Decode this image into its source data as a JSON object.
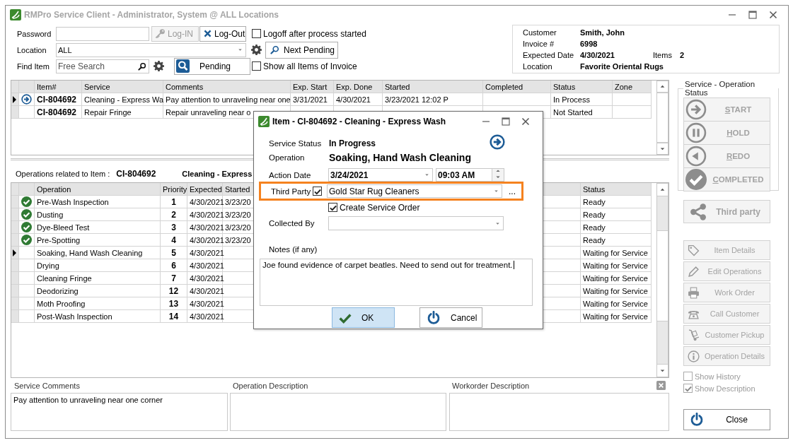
{
  "window": {
    "title": "RMPro Service Client - Administrator, System @ ALL Locations"
  },
  "login": {
    "password_label": "Password",
    "buttons": [
      {
        "kind": "login",
        "label": "Log-IN",
        "disabled": true
      },
      {
        "kind": "logout",
        "label": "Log-Out",
        "disabled": false
      }
    ],
    "logoff_after": {
      "label": "Logoff after process started",
      "checked": false
    }
  },
  "location": {
    "label": "Location",
    "value": "ALL",
    "next_pending": "Next Pending"
  },
  "find": {
    "label": "Find Item",
    "placeholder": "Free Search",
    "pending": "Pending",
    "show_all": {
      "label": "Show all Items of Invoice",
      "checked": false
    }
  },
  "invoice": {
    "fields": [
      {
        "label": "Customer",
        "value": "Smith, John"
      },
      {
        "label": "Invoice #",
        "value": "6998"
      },
      {
        "label": "Expected Date",
        "value": "4/30/2021"
      },
      {
        "label": "Location",
        "value": "Favorite Oriental Rugs"
      }
    ],
    "items_label": "Items",
    "items_value": "2"
  },
  "items_table": {
    "columns": [
      "Item#",
      "Service",
      "Comments",
      "Exp. Start",
      "Exp. Done",
      "Started",
      "Completed",
      "Status",
      "Zone"
    ],
    "rows": [
      {
        "selected": true,
        "current": true,
        "item": "CI-804692",
        "service": "Cleaning - Express Wa",
        "comments": "Pay attention to unraveling near one",
        "exp_start": "3/31/2021",
        "exp_done": "4/30/2021",
        "started": "3/23/2021 12:02 P",
        "status": "In Process"
      },
      {
        "selected": false,
        "current": false,
        "item": "CI-804692",
        "service": "Repair Fringe",
        "comments": "Repair unraveling near o",
        "status": "Not Started"
      }
    ]
  },
  "operations": {
    "label": "Operations related to Item :",
    "item": "CI-804692",
    "service": "Cleaning - Express",
    "columns": [
      "Operation",
      "Priority",
      "Expected",
      "Started",
      "Status"
    ],
    "rows": [
      {
        "selected": false,
        "done": true,
        "operation": "Pre-Wash Inspection",
        "priority": "1",
        "expected": "4/30/2021",
        "started": "3/23/20",
        "status": "Ready"
      },
      {
        "selected": false,
        "done": true,
        "operation": "Dusting",
        "priority": "2",
        "expected": "4/30/2021",
        "started": "3/23/20",
        "status": "Ready"
      },
      {
        "selected": false,
        "done": true,
        "operation": "Dye-Bleed Test",
        "priority": "3",
        "expected": "4/30/2021",
        "started": "3/23/20",
        "status": "Ready"
      },
      {
        "selected": false,
        "done": true,
        "operation": "Pre-Spotting",
        "priority": "4",
        "expected": "4/30/2021",
        "started": "3/23/20",
        "status": "Ready"
      },
      {
        "selected": true,
        "done": false,
        "operation": "Soaking, Hand Wash Cleaning",
        "priority": "5",
        "expected": "4/30/2021",
        "status": "Waiting for Service"
      },
      {
        "selected": false,
        "done": false,
        "operation": "Drying",
        "priority": "6",
        "expected": "4/30/2021",
        "status": "Waiting for Service"
      },
      {
        "selected": false,
        "done": false,
        "operation": "Cleaning Fringe",
        "priority": "7",
        "expected": "4/30/2021",
        "status": "Waiting for Service"
      },
      {
        "selected": false,
        "done": false,
        "operation": "Deodorizing",
        "priority": "12",
        "expected": "4/30/2021",
        "status": "Waiting for Service"
      },
      {
        "selected": false,
        "done": false,
        "operation": "Moth Proofing",
        "priority": "13",
        "expected": "4/30/2021",
        "status": "Waiting for Service"
      },
      {
        "selected": false,
        "done": false,
        "operation": "Post-Wash Inspection",
        "priority": "14",
        "expected": "4/30/2021",
        "status": "Waiting for Service"
      }
    ]
  },
  "panes": [
    {
      "title": "Service Comments",
      "text": "Pay attention to unraveling near one corner"
    },
    {
      "title": "Operation Description"
    },
    {
      "title": "Workorder Description"
    }
  ],
  "side": {
    "group_title": "Service - Operation Status",
    "status_buttons": [
      {
        "kind": "start",
        "label": "START",
        "disabled": true
      },
      {
        "kind": "hold",
        "label": "HOLD",
        "disabled": true
      },
      {
        "kind": "redo",
        "label": "REDO",
        "disabled": true
      },
      {
        "kind": "completed",
        "label": "COMPLETED",
        "disabled": true
      }
    ],
    "third_party": {
      "label": "Third party",
      "disabled": true
    },
    "actions": [
      {
        "kind": "tag",
        "label": "Item Details",
        "disabled": true
      },
      {
        "kind": "pencil",
        "label": "Edit Operations",
        "disabled": true
      },
      {
        "kind": "printer",
        "label": "Work Order",
        "disabled": true
      },
      {
        "kind": "phone",
        "label": "Call Customer",
        "disabled": true
      },
      {
        "kind": "dolly",
        "label": "Customer Pickup",
        "disabled": true
      },
      {
        "kind": "info",
        "label": "Operation Details",
        "disabled": true
      }
    ],
    "options": [
      {
        "label": "Show History",
        "checked": false,
        "disabled": true
      },
      {
        "label": "Show Description",
        "checked": true,
        "disabled": true
      }
    ],
    "close": "Close"
  },
  "dialog": {
    "title": "Item - CI-804692 - Cleaning - Express Wash",
    "service_status_label": "Service Status",
    "service_status": "In Progress",
    "operation_label": "Operation",
    "operation": "Soaking, Hand Wash Cleaning",
    "action_date_label": "Action Date",
    "action_date": "3/24/2021",
    "action_time": "09:03 AM",
    "third_party_label": "Third Party",
    "third_party_checked": true,
    "third_party_highlighted": true,
    "third_party": "Gold Star Rug Cleaners",
    "browse": "...",
    "create_order": {
      "label": "Create Service Order",
      "checked": true
    },
    "collected_by_label": "Collected By",
    "notes_label": "Notes (if any)",
    "notes": "Joe found evidence of carpet beatles. Need to send out for treatment.",
    "buttons": [
      {
        "kind": "ok",
        "label": "OK",
        "default": true
      },
      {
        "kind": "cancel",
        "label": "Cancel",
        "default": false
      }
    ]
  }
}
